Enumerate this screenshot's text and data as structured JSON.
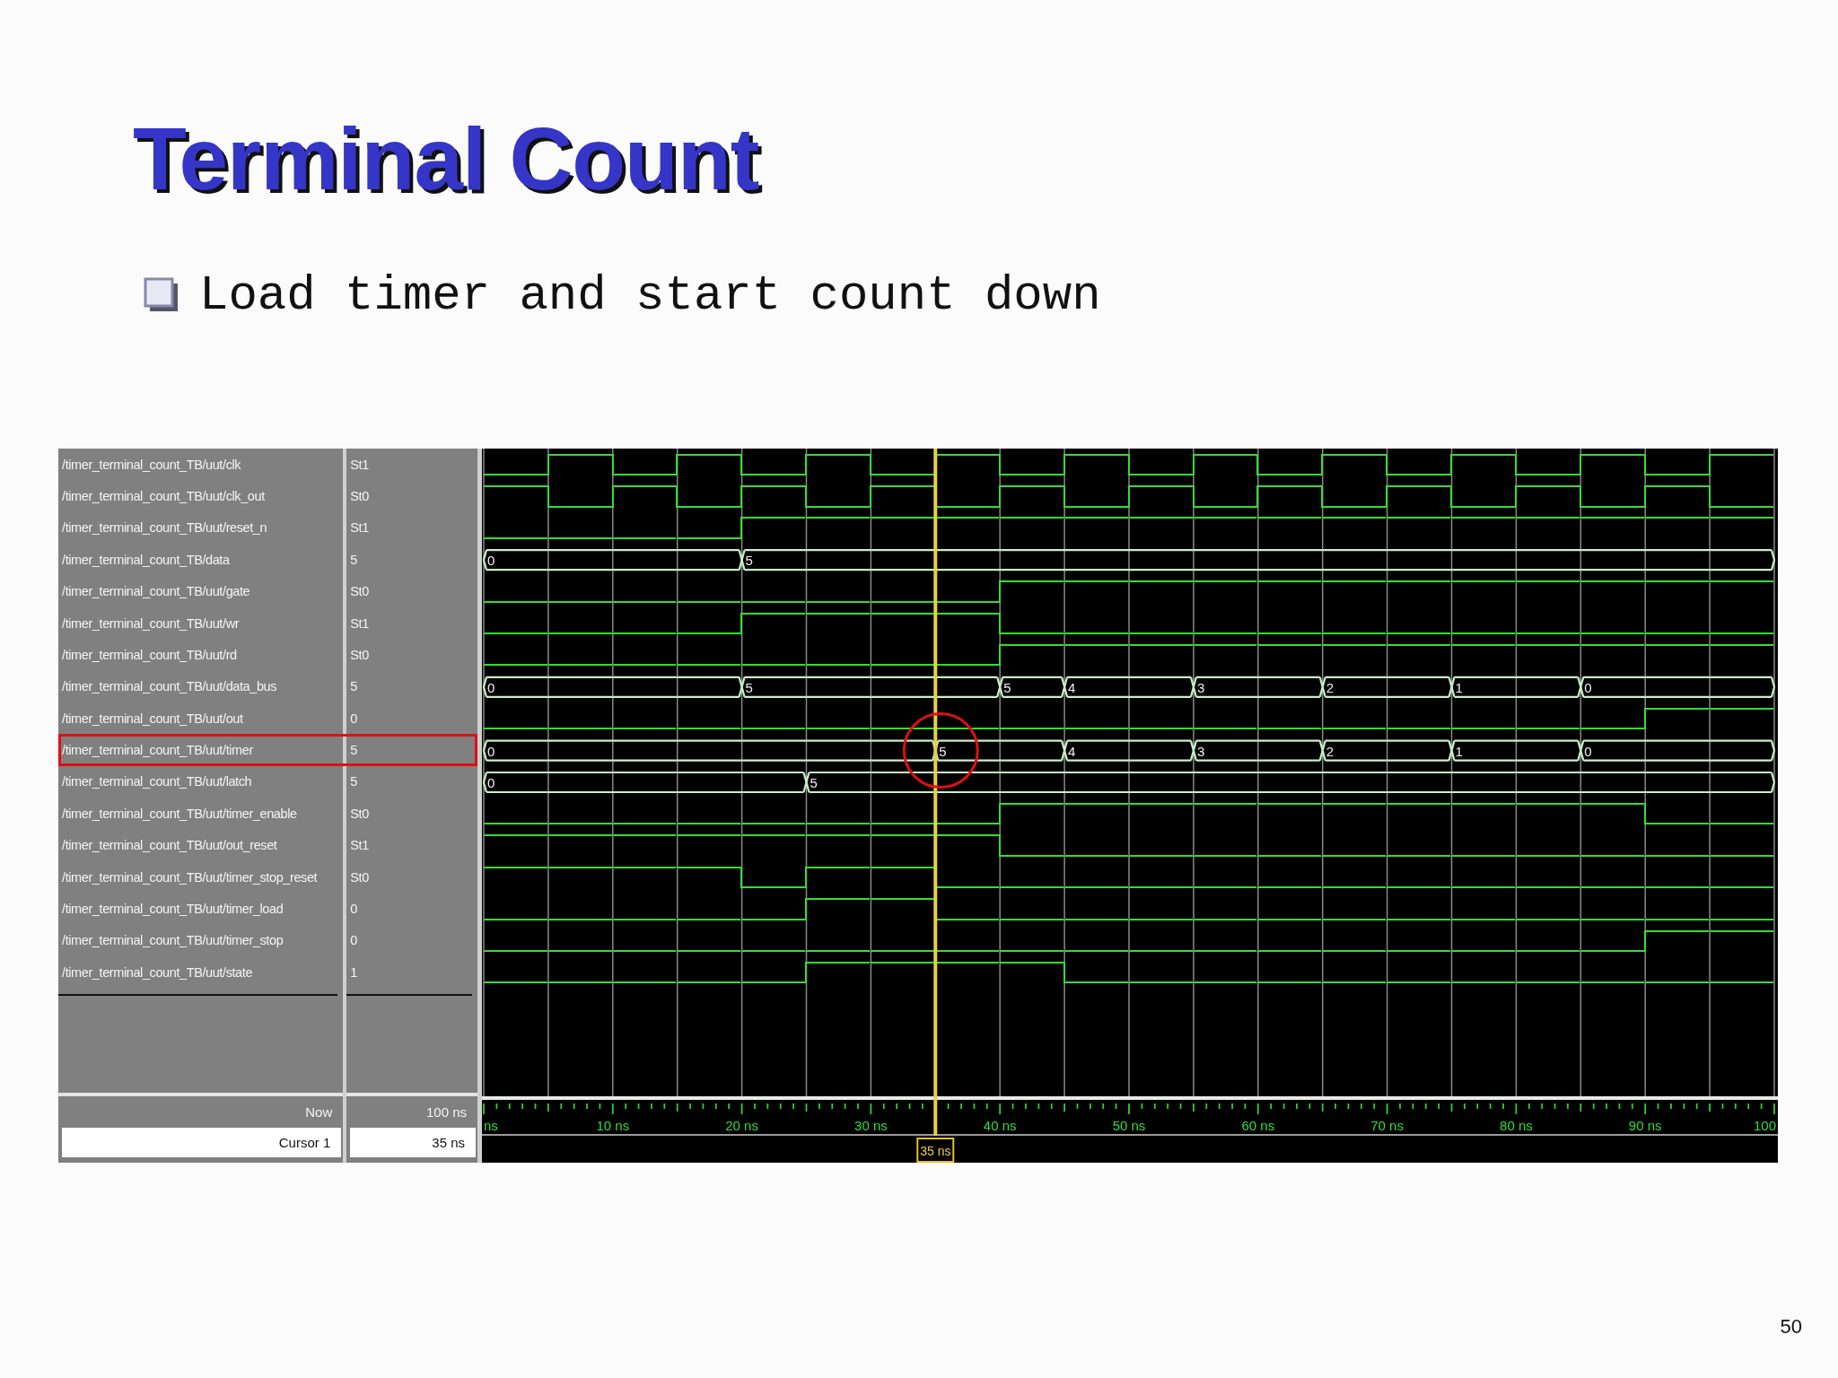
{
  "slide": {
    "title": "Terminal Count",
    "bullets": [
      "Load timer and start count down"
    ],
    "page_number": "50"
  },
  "waveform": {
    "signals": [
      {
        "name": "/timer_terminal_count_TB/uut/clk",
        "value": "St1",
        "kind": "bit",
        "highlighted": false,
        "segments": [
          {
            "high": false
          },
          {
            "high": true
          },
          {
            "high": false
          },
          {
            "high": true
          },
          {
            "high": false
          },
          {
            "high": true
          },
          {
            "high": false
          },
          {
            "high": true
          },
          {
            "high": false
          },
          {
            "high": true
          },
          {
            "high": false
          },
          {
            "high": true
          },
          {
            "high": false
          },
          {
            "high": true
          },
          {
            "high": false
          },
          {
            "high": true
          },
          {
            "high": false
          },
          {
            "high": true
          },
          {
            "high": false
          },
          {
            "high": true
          }
        ]
      },
      {
        "name": "/timer_terminal_count_TB/uut/clk_out",
        "value": "St0",
        "kind": "bit",
        "highlighted": false,
        "segments": [
          {
            "high": true
          },
          {
            "high": false
          },
          {
            "high": true
          },
          {
            "high": false
          },
          {
            "high": true
          },
          {
            "high": false
          },
          {
            "high": true
          },
          {
            "high": false
          },
          {
            "high": true
          },
          {
            "high": false
          },
          {
            "high": true
          },
          {
            "high": false
          },
          {
            "high": true
          },
          {
            "high": false
          },
          {
            "high": true
          },
          {
            "high": false
          },
          {
            "high": true
          },
          {
            "high": false
          },
          {
            "high": true
          },
          {
            "high": false
          }
        ]
      },
      {
        "name": "/timer_terminal_count_TB/uut/reset_n",
        "value": "St1",
        "kind": "bit",
        "highlighted": false,
        "segments": [
          {
            "high": false
          },
          {
            "high": false
          },
          {
            "high": false
          },
          {
            "high": false
          },
          {
            "high": true
          },
          {
            "high": true
          },
          {
            "high": true
          },
          {
            "high": true
          },
          {
            "high": true
          },
          {
            "high": true
          },
          {
            "high": true
          },
          {
            "high": true
          },
          {
            "high": true
          },
          {
            "high": true
          },
          {
            "high": true
          },
          {
            "high": true
          },
          {
            "high": true
          },
          {
            "high": true
          },
          {
            "high": true
          },
          {
            "high": true
          }
        ]
      },
      {
        "name": "/timer_terminal_count_TB/data",
        "value": "5",
        "kind": "bus",
        "highlighted": false,
        "segments": [
          {
            "change": true,
            "value": "0"
          },
          {
            "change": false
          },
          {
            "change": false
          },
          {
            "change": false
          },
          {
            "change": true,
            "value": "5"
          },
          {
            "change": false
          },
          {
            "change": false
          },
          {
            "change": false
          },
          {
            "change": false
          },
          {
            "change": false
          },
          {
            "change": false
          },
          {
            "change": false
          },
          {
            "change": false
          },
          {
            "change": false
          },
          {
            "change": false
          },
          {
            "change": false
          },
          {
            "change": false
          },
          {
            "change": false
          },
          {
            "change": false
          },
          {
            "change": false
          }
        ]
      },
      {
        "name": "/timer_terminal_count_TB/uut/gate",
        "value": "St0",
        "kind": "bit",
        "highlighted": false,
        "segments": [
          {
            "high": false
          },
          {
            "high": false
          },
          {
            "high": false
          },
          {
            "high": false
          },
          {
            "high": false
          },
          {
            "high": false
          },
          {
            "high": false
          },
          {
            "high": false
          },
          {
            "high": true
          },
          {
            "high": true
          },
          {
            "high": true
          },
          {
            "high": true
          },
          {
            "high": true
          },
          {
            "high": true
          },
          {
            "high": true
          },
          {
            "high": true
          },
          {
            "high": true
          },
          {
            "high": true
          },
          {
            "high": true
          },
          {
            "high": true
          }
        ]
      },
      {
        "name": "/timer_terminal_count_TB/uut/wr",
        "value": "St1",
        "kind": "bit",
        "highlighted": false,
        "segments": [
          {
            "high": false
          },
          {
            "high": false
          },
          {
            "high": false
          },
          {
            "high": false
          },
          {
            "high": true
          },
          {
            "high": true
          },
          {
            "high": true
          },
          {
            "high": true
          },
          {
            "high": false
          },
          {
            "high": false
          },
          {
            "high": false
          },
          {
            "high": false
          },
          {
            "high": false
          },
          {
            "high": false
          },
          {
            "high": false
          },
          {
            "high": false
          },
          {
            "high": false
          },
          {
            "high": false
          },
          {
            "high": false
          },
          {
            "high": false
          }
        ]
      },
      {
        "name": "/timer_terminal_count_TB/uut/rd",
        "value": "St0",
        "kind": "bit",
        "highlighted": false,
        "segments": [
          {
            "high": false
          },
          {
            "high": false
          },
          {
            "high": false
          },
          {
            "high": false
          },
          {
            "high": false
          },
          {
            "high": false
          },
          {
            "high": false
          },
          {
            "high": false
          },
          {
            "high": true
          },
          {
            "high": true
          },
          {
            "high": true
          },
          {
            "high": true
          },
          {
            "high": true
          },
          {
            "high": true
          },
          {
            "high": true
          },
          {
            "high": true
          },
          {
            "high": true
          },
          {
            "high": true
          },
          {
            "high": true
          },
          {
            "high": true
          }
        ]
      },
      {
        "name": "/timer_terminal_count_TB/uut/data_bus",
        "value": "5",
        "kind": "bus",
        "highlighted": false,
        "segments": [
          {
            "change": true,
            "value": "0"
          },
          {
            "change": false
          },
          {
            "change": false
          },
          {
            "change": false
          },
          {
            "change": true,
            "value": "5"
          },
          {
            "change": false
          },
          {
            "change": false
          },
          {
            "change": false
          },
          {
            "change": true,
            "value": "5"
          },
          {
            "change": true,
            "value": "4"
          },
          {
            "change": false
          },
          {
            "change": true,
            "value": "3"
          },
          {
            "change": false
          },
          {
            "change": true,
            "value": "2"
          },
          {
            "change": false
          },
          {
            "change": true,
            "value": "1"
          },
          {
            "change": false
          },
          {
            "change": true,
            "value": "0"
          },
          {
            "change": false
          },
          {
            "change": false
          }
        ]
      },
      {
        "name": "/timer_terminal_count_TB/uut/out",
        "value": "0",
        "kind": "bit",
        "highlighted": false,
        "segments": [
          {
            "high": false
          },
          {
            "high": false
          },
          {
            "high": false
          },
          {
            "high": false
          },
          {
            "high": false
          },
          {
            "high": false
          },
          {
            "high": false
          },
          {
            "high": false
          },
          {
            "high": false
          },
          {
            "high": false
          },
          {
            "high": false
          },
          {
            "high": false
          },
          {
            "high": false
          },
          {
            "high": false
          },
          {
            "high": false
          },
          {
            "high": false
          },
          {
            "high": false
          },
          {
            "high": false
          },
          {
            "high": true
          },
          {
            "high": true
          }
        ]
      },
      {
        "name": "/timer_terminal_count_TB/uut/timer",
        "value": "5",
        "kind": "bus",
        "highlighted": true,
        "segments": [
          {
            "change": true,
            "value": "0"
          },
          {
            "change": false
          },
          {
            "change": false
          },
          {
            "change": false
          },
          {
            "change": false
          },
          {
            "change": false
          },
          {
            "change": false
          },
          {
            "change": true,
            "value": "5"
          },
          {
            "change": false
          },
          {
            "change": true,
            "value": "4"
          },
          {
            "change": false
          },
          {
            "change": true,
            "value": "3"
          },
          {
            "change": false
          },
          {
            "change": true,
            "value": "2"
          },
          {
            "change": false
          },
          {
            "change": true,
            "value": "1"
          },
          {
            "change": false
          },
          {
            "change": true,
            "value": "0"
          },
          {
            "change": false
          },
          {
            "change": false
          }
        ]
      },
      {
        "name": "/timer_terminal_count_TB/uut/latch",
        "value": "5",
        "kind": "bus",
        "highlighted": false,
        "segments": [
          {
            "change": true,
            "value": "0"
          },
          {
            "change": false
          },
          {
            "change": false
          },
          {
            "change": false
          },
          {
            "change": false
          },
          {
            "change": true,
            "value": "5"
          },
          {
            "change": false
          },
          {
            "change": false
          },
          {
            "change": false
          },
          {
            "change": false
          },
          {
            "change": false
          },
          {
            "change": false
          },
          {
            "change": false
          },
          {
            "change": false
          },
          {
            "change": false
          },
          {
            "change": false
          },
          {
            "change": false
          },
          {
            "change": false
          },
          {
            "change": false
          },
          {
            "change": false
          }
        ]
      },
      {
        "name": "/timer_terminal_count_TB/uut/timer_enable",
        "value": "St0",
        "kind": "bit",
        "highlighted": false,
        "segments": [
          {
            "high": false
          },
          {
            "high": false
          },
          {
            "high": false
          },
          {
            "high": false
          },
          {
            "high": false
          },
          {
            "high": false
          },
          {
            "high": false
          },
          {
            "high": false
          },
          {
            "high": true
          },
          {
            "high": true
          },
          {
            "high": true
          },
          {
            "high": true
          },
          {
            "high": true
          },
          {
            "high": true
          },
          {
            "high": true
          },
          {
            "high": true
          },
          {
            "high": true
          },
          {
            "high": true
          },
          {
            "high": false
          },
          {
            "high": false
          }
        ]
      },
      {
        "name": "/timer_terminal_count_TB/uut/out_reset",
        "value": "St1",
        "kind": "bit",
        "highlighted": false,
        "segments": [
          {
            "high": true
          },
          {
            "high": true
          },
          {
            "high": true
          },
          {
            "high": true
          },
          {
            "high": true
          },
          {
            "high": true
          },
          {
            "high": true
          },
          {
            "high": true
          },
          {
            "high": false
          },
          {
            "high": false
          },
          {
            "high": false
          },
          {
            "high": false
          },
          {
            "high": false
          },
          {
            "high": false
          },
          {
            "high": false
          },
          {
            "high": false
          },
          {
            "high": false
          },
          {
            "high": false
          },
          {
            "high": false
          },
          {
            "high": false
          }
        ]
      },
      {
        "name": "/timer_terminal_count_TB/uut/timer_stop_reset",
        "value": "St0",
        "kind": "bit",
        "highlighted": false,
        "segments": [
          {
            "high": true
          },
          {
            "high": true
          },
          {
            "high": true
          },
          {
            "high": true
          },
          {
            "high": false
          },
          {
            "high": true
          },
          {
            "high": true
          },
          {
            "high": false
          },
          {
            "high": false
          },
          {
            "high": false
          },
          {
            "high": false
          },
          {
            "high": false
          },
          {
            "high": false
          },
          {
            "high": false
          },
          {
            "high": false
          },
          {
            "high": false
          },
          {
            "high": false
          },
          {
            "high": false
          },
          {
            "high": false
          },
          {
            "high": false
          }
        ]
      },
      {
        "name": "/timer_terminal_count_TB/uut/timer_load",
        "value": "0",
        "kind": "bit",
        "highlighted": false,
        "segments": [
          {
            "high": false
          },
          {
            "high": false
          },
          {
            "high": false
          },
          {
            "high": false
          },
          {
            "high": false
          },
          {
            "high": true
          },
          {
            "high": true
          },
          {
            "high": false
          },
          {
            "high": false
          },
          {
            "high": false
          },
          {
            "high": false
          },
          {
            "high": false
          },
          {
            "high": false
          },
          {
            "high": false
          },
          {
            "high": false
          },
          {
            "high": false
          },
          {
            "high": false
          },
          {
            "high": false
          },
          {
            "high": false
          },
          {
            "high": false
          }
        ]
      },
      {
        "name": "/timer_terminal_count_TB/uut/timer_stop",
        "value": "0",
        "kind": "bit",
        "highlighted": false,
        "segments": [
          {
            "high": false
          },
          {
            "high": false
          },
          {
            "high": false
          },
          {
            "high": false
          },
          {
            "high": false
          },
          {
            "high": false
          },
          {
            "high": false
          },
          {
            "high": false
          },
          {
            "high": false
          },
          {
            "high": false
          },
          {
            "high": false
          },
          {
            "high": false
          },
          {
            "high": false
          },
          {
            "high": false
          },
          {
            "high": false
          },
          {
            "high": false
          },
          {
            "high": false
          },
          {
            "high": false
          },
          {
            "high": true
          },
          {
            "high": true
          }
        ]
      },
      {
        "name": "/timer_terminal_count_TB/uut/state",
        "value": "1",
        "kind": "bit",
        "highlighted": false,
        "segments": [
          {
            "high": false
          },
          {
            "high": false
          },
          {
            "high": false
          },
          {
            "high": false
          },
          {
            "high": false
          },
          {
            "high": true
          },
          {
            "high": true
          },
          {
            "high": true
          },
          {
            "high": true
          },
          {
            "high": false
          },
          {
            "high": false
          },
          {
            "high": false
          },
          {
            "high": false
          },
          {
            "high": false
          },
          {
            "high": false
          },
          {
            "high": false
          },
          {
            "high": false
          },
          {
            "high": false
          },
          {
            "high": false
          },
          {
            "high": false
          }
        ]
      }
    ],
    "now": {
      "label": "Now",
      "value": "100 ns"
    },
    "cursor": {
      "label": "Cursor 1",
      "value": "35 ns",
      "marker": "35 ns"
    },
    "time_labels": [
      "ns",
      "10 ns",
      "20 ns",
      "30 ns",
      "40 ns",
      "50 ns",
      "60 ns",
      "70 ns",
      "80 ns",
      "90 ns",
      "100"
    ]
  }
}
